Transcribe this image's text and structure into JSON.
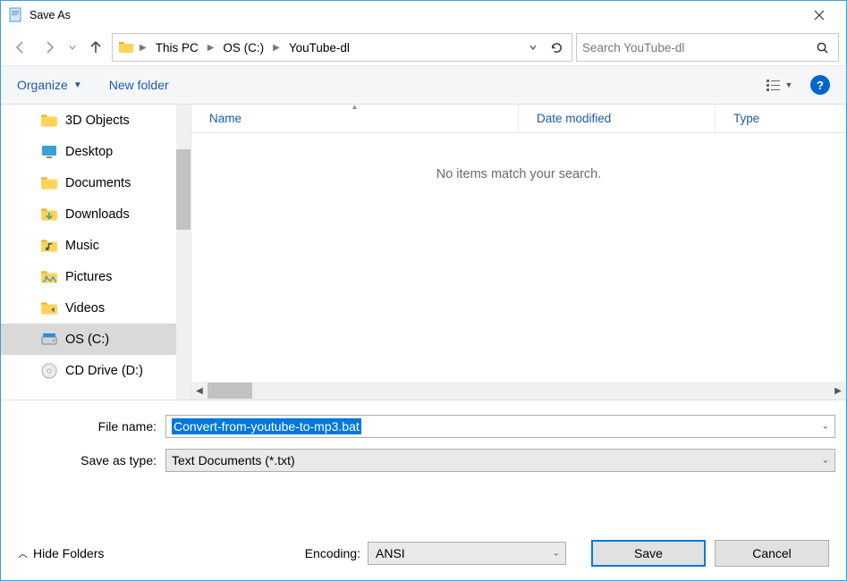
{
  "window": {
    "title": "Save As"
  },
  "nav": {
    "breadcrumbs": [
      "This PC",
      "OS (C:)",
      "YouTube-dl"
    ]
  },
  "search": {
    "placeholder": "Search YouTube-dl"
  },
  "commandbar": {
    "organize": "Organize",
    "newfolder": "New folder"
  },
  "sidebar": {
    "items": [
      {
        "label": "3D Objects",
        "icon": "folder"
      },
      {
        "label": "Desktop",
        "icon": "desktop"
      },
      {
        "label": "Documents",
        "icon": "folder"
      },
      {
        "label": "Downloads",
        "icon": "downloads"
      },
      {
        "label": "Music",
        "icon": "music"
      },
      {
        "label": "Pictures",
        "icon": "pictures"
      },
      {
        "label": "Videos",
        "icon": "videos"
      },
      {
        "label": "OS (C:)",
        "icon": "drive",
        "selected": true
      },
      {
        "label": "CD Drive (D:)",
        "icon": "cd"
      }
    ]
  },
  "filelist": {
    "columns": {
      "name": "Name",
      "date": "Date modified",
      "type": "Type"
    },
    "empty_message": "No items match your search."
  },
  "form": {
    "filename_label": "File name:",
    "filename_value": "Convert-from-youtube-to-mp3.bat",
    "savetype_label": "Save as type:",
    "savetype_value": "Text Documents (*.txt)",
    "encoding_label": "Encoding:",
    "encoding_value": "ANSI"
  },
  "buttons": {
    "hide_folders": "Hide Folders",
    "save": "Save",
    "cancel": "Cancel"
  }
}
